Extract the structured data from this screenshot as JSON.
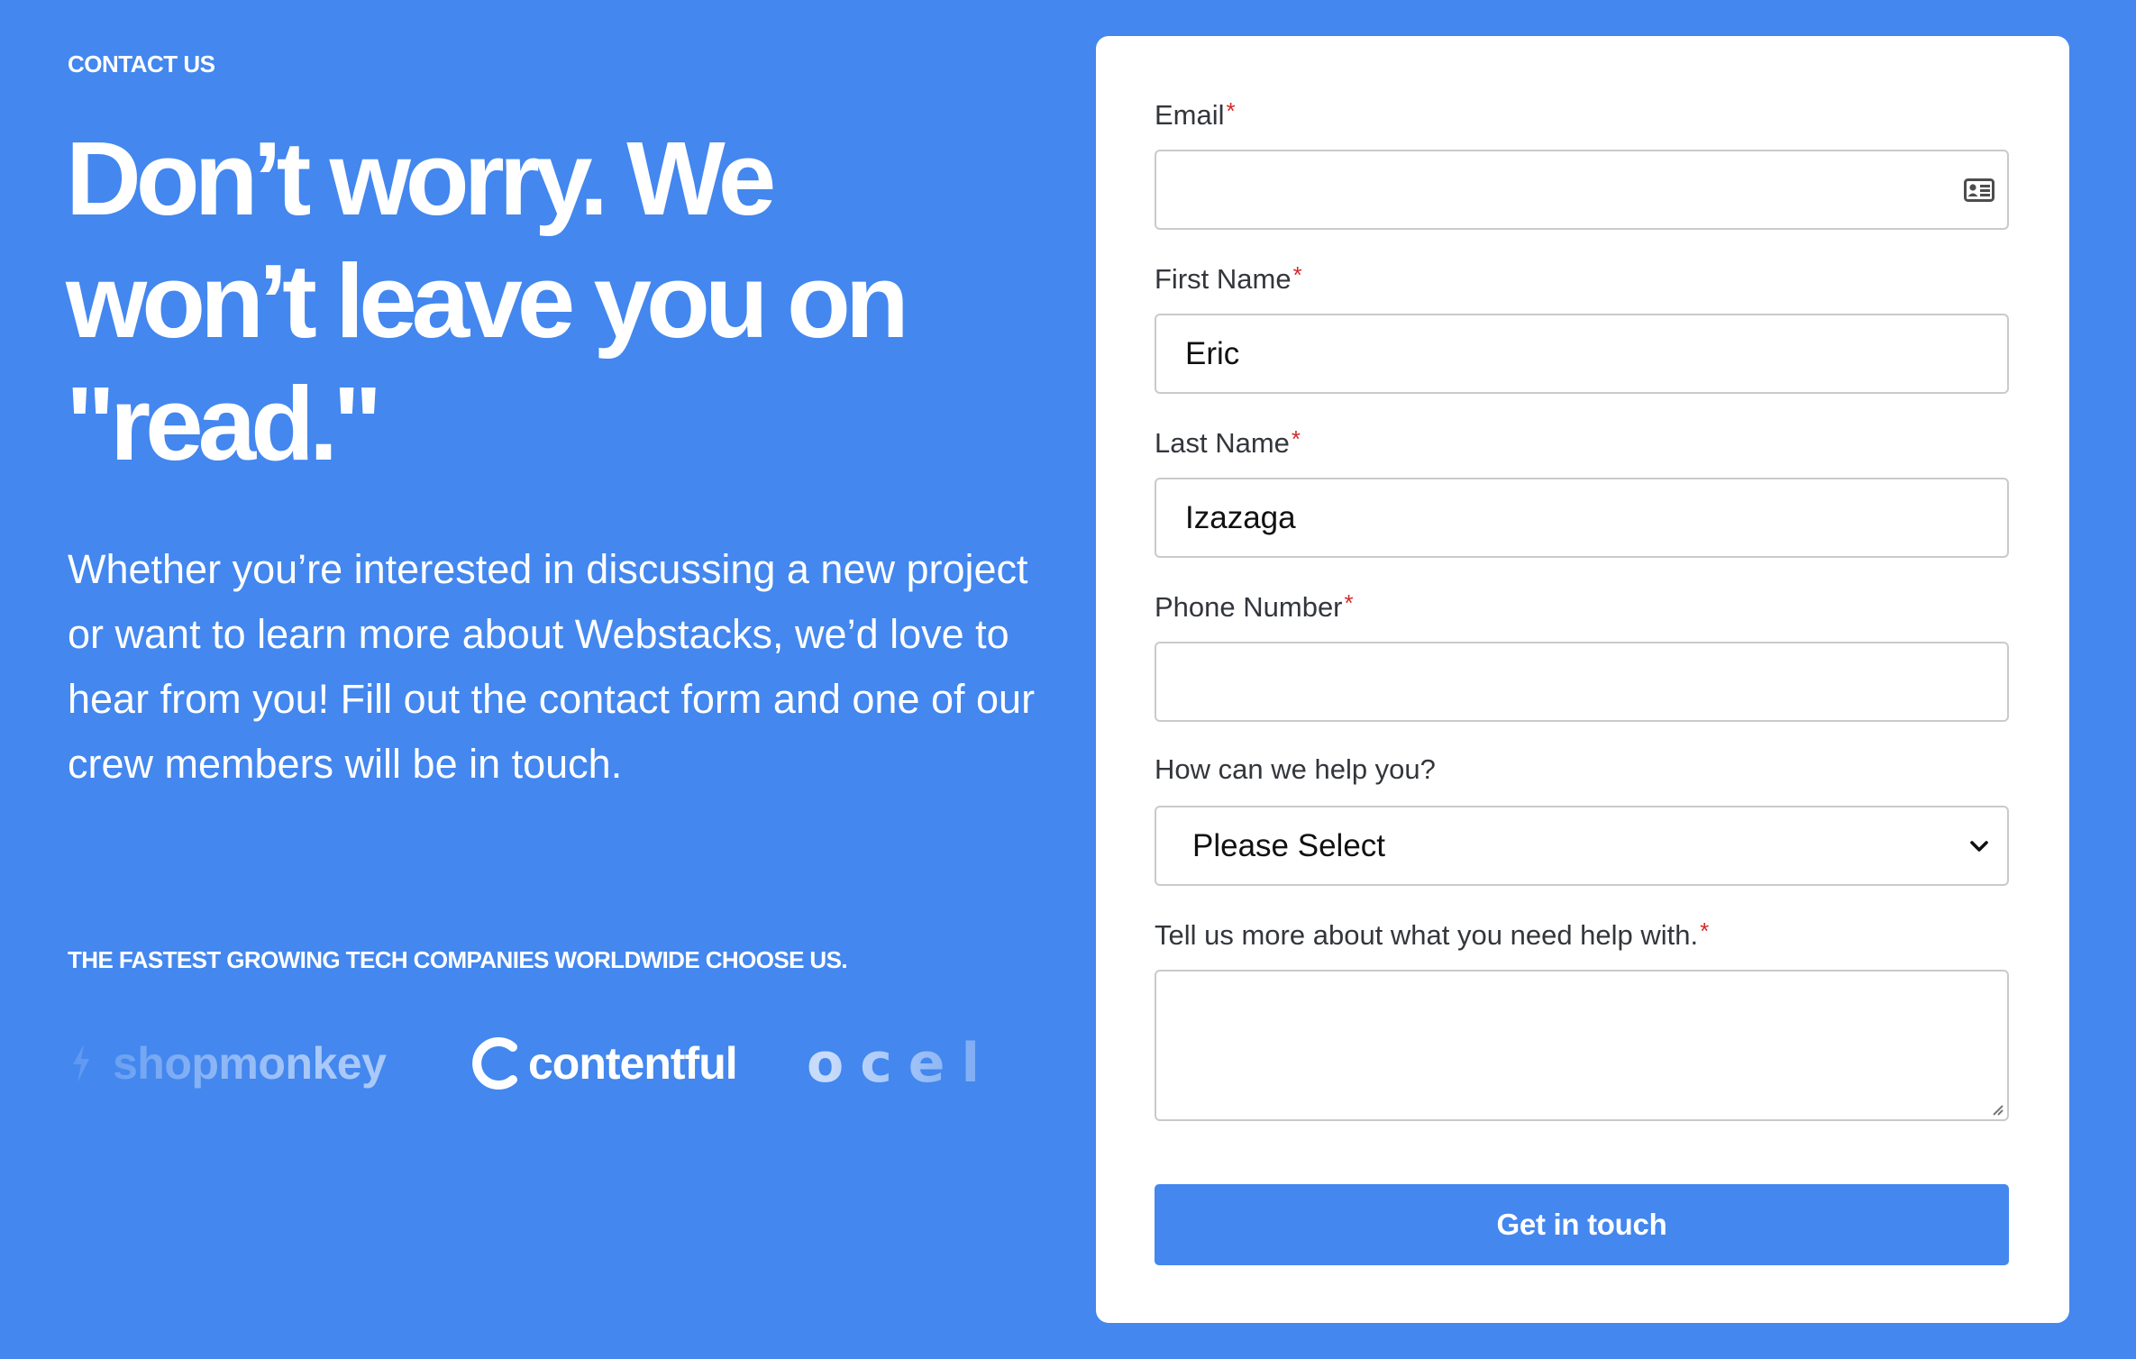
{
  "hero": {
    "eyebrow": "CONTACT US",
    "headline": "Don’t worry. We won’t leave you on \"read.\"",
    "lead": "Whether you’re interested in discussing a new project or want to learn more about Webstacks, we’d love to hear from you! Fill out the contact form and one of our crew members will be in touch.",
    "logos_heading": "THE FASTEST GROWING TECH COMPANIES WORLDWIDE CHOOSE US.",
    "logos": [
      {
        "name": "shopmonkey",
        "icon": "shopmonkey-logo"
      },
      {
        "name": "contentful",
        "icon": "contentful-logo"
      },
      {
        "name": "ocelot",
        "icon": "ocelot-logo",
        "visible_text": "ocel"
      }
    ]
  },
  "form": {
    "email": {
      "label": "Email",
      "required_mark": "*",
      "value": "",
      "icon": "contact-card-icon"
    },
    "first_name": {
      "label": "First Name",
      "required_mark": "*",
      "value": "Eric"
    },
    "last_name": {
      "label": "Last Name",
      "required_mark": "*",
      "value": "Izazaga"
    },
    "phone": {
      "label": "Phone Number",
      "required_mark": "*",
      "value": ""
    },
    "help_topic": {
      "label": "How can we help you?",
      "selected": "Please Select",
      "icon": "chevron-down-icon"
    },
    "details": {
      "label": "Tell us more about what you need help with.",
      "required_mark": "*",
      "value": ""
    },
    "submit_label": "Get in touch"
  },
  "colors": {
    "background": "#4387ef",
    "card": "#ffffff",
    "button": "#4387ef",
    "required": "#d42a2a",
    "input_border": "#c9cacd"
  }
}
